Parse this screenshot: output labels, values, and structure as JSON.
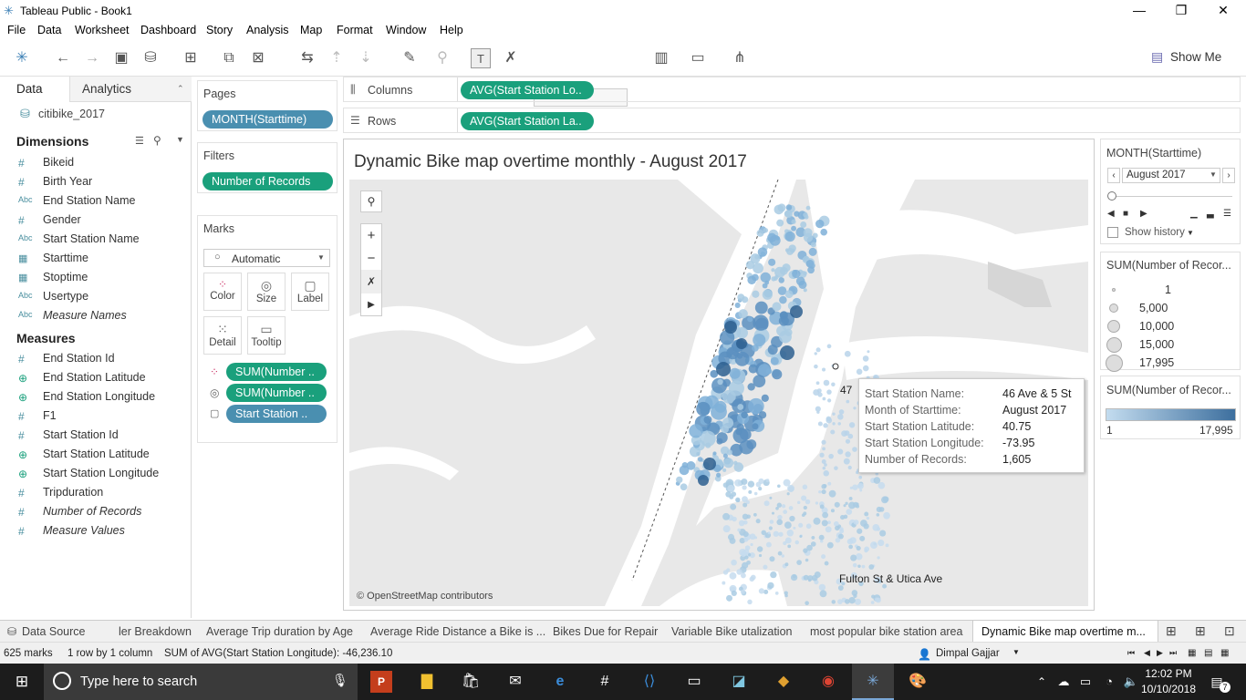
{
  "app": {
    "title": "Tableau Public - Book1"
  },
  "menu": [
    "File",
    "Data",
    "Worksheet",
    "Dashboard",
    "Story",
    "Analysis",
    "Map",
    "Format",
    "Window",
    "Help"
  ],
  "toolbar": {
    "show_me": "Show Me"
  },
  "sidebar": {
    "tab_data": "Data",
    "tab_analytics": "Analytics",
    "datasource": "citibike_2017",
    "dimensions_title": "Dimensions",
    "dimensions": [
      {
        "icon": "#",
        "label": "Bikeid"
      },
      {
        "icon": "#",
        "label": "Birth Year"
      },
      {
        "icon": "Abc",
        "label": "End Station Name"
      },
      {
        "icon": "#",
        "label": "Gender"
      },
      {
        "icon": "Abc",
        "label": "Start Station Name"
      },
      {
        "icon": "cal",
        "label": "Starttime"
      },
      {
        "icon": "cal",
        "label": "Stoptime"
      },
      {
        "icon": "Abc",
        "label": "Usertype"
      },
      {
        "icon": "Abc",
        "label": "Measure Names"
      }
    ],
    "measures_title": "Measures",
    "measures": [
      {
        "icon": "#",
        "label": "End Station Id"
      },
      {
        "icon": "globe",
        "label": "End Station Latitude"
      },
      {
        "icon": "globe",
        "label": "End Station Longitude"
      },
      {
        "icon": "#",
        "label": "F1"
      },
      {
        "icon": "#",
        "label": "Start Station Id"
      },
      {
        "icon": "globe",
        "label": "Start Station Latitude"
      },
      {
        "icon": "globe",
        "label": "Start Station Longitude"
      },
      {
        "icon": "#",
        "label": "Tripduration"
      },
      {
        "icon": "#",
        "label": "Number of Records"
      },
      {
        "icon": "#",
        "label": "Measure Values"
      }
    ]
  },
  "pages": {
    "title": "Pages",
    "pill": "MONTH(Starttime)"
  },
  "filters": {
    "title": "Filters",
    "pill": "Number of Records"
  },
  "marks": {
    "title": "Marks",
    "type": "Automatic",
    "color": "Color",
    "size": "Size",
    "label": "Label",
    "detail": "Detail",
    "tooltip": "Tooltip",
    "pills": [
      "SUM(Number ..",
      "SUM(Number ..",
      "Start Station .."
    ]
  },
  "columns": {
    "label": "Columns",
    "pill": "AVG(Start Station Lo.."
  },
  "rows": {
    "label": "Rows",
    "pill": "AVG(Start Station La.."
  },
  "view": {
    "title": "Dynamic Bike map overtime monthly  - August 2017",
    "attribution": "© OpenStreetMap contributors",
    "label_fulton": "Fulton St & Utica Ave",
    "label_47": "47"
  },
  "tooltip": {
    "rows": [
      {
        "k": "Start Station Name:",
        "v": "46 Ave & 5 St"
      },
      {
        "k": "Month of Starttime:",
        "v": "August 2017"
      },
      {
        "k": "Start Station Latitude:",
        "v": "40.75"
      },
      {
        "k": "Start Station Longitude:",
        "v": "-73.95"
      },
      {
        "k": "Number of Records:",
        "v": "1,605"
      }
    ]
  },
  "page_control": {
    "title": "MONTH(Starttime)",
    "value": "August 2017",
    "show_history": "Show history"
  },
  "size_legend": {
    "title": "SUM(Number of Recor...",
    "items": [
      "1",
      "5,000",
      "10,000",
      "15,000",
      "17,995"
    ]
  },
  "color_legend": {
    "title": "SUM(Number of Recor...",
    "min": "1",
    "max": "17,995"
  },
  "sheet_tabs": [
    "Data Source",
    "ler Breakdown",
    "Average Trip duration by Age",
    "Average Ride Distance a Bike is ...",
    "Bikes Due for Repair",
    "Variable Bike utalization",
    "most popular bike station area",
    "Dynamic Bike map overtime m..."
  ],
  "status": {
    "marks": "625 marks",
    "rows": "1 row by 1 column",
    "sum": "SUM of AVG(Start Station Longitude): -46,236.10",
    "user": "Dimpal Gajjar"
  },
  "taskbar": {
    "search": "Type here to search",
    "time": "12:02 PM",
    "date": "10/10/2018",
    "badge": "7"
  },
  "colors": {
    "green": "#1aa07c",
    "blue": "#4a8fb0",
    "map_dark": "#2d5f8f",
    "map_light": "#a9cbe3"
  }
}
